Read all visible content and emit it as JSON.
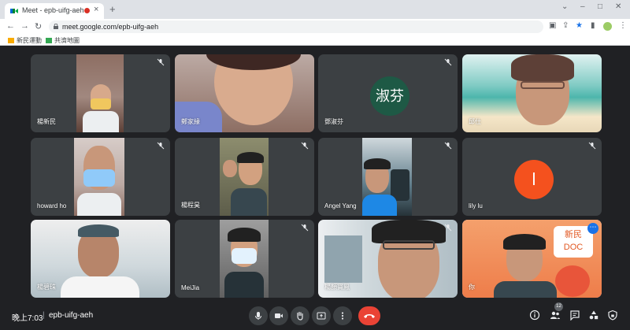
{
  "browser": {
    "tab_title": "Meet - epb-uifg-aeh",
    "new_tab_symbol": "+",
    "tab_close_symbol": "×",
    "window_minimize": "–",
    "window_maximize": "□",
    "window_close": "✕",
    "url": "meet.google.com/epb-uifg-aeh",
    "bookmarks": [
      {
        "label": "新民運動"
      },
      {
        "label": "共濟地圖"
      }
    ]
  },
  "participants": [
    {
      "name": "楊新民",
      "avatar_letter": "",
      "muted": true
    },
    {
      "name": "鄭家緣",
      "avatar_letter": "",
      "muted": false
    },
    {
      "name": "鄧淑芬",
      "avatar_letter": "淑芬",
      "avatar_color": "#1e5945",
      "muted": true
    },
    {
      "name": "邱仕",
      "avatar_letter": "",
      "muted": false
    },
    {
      "name": "howard ho",
      "avatar_letter": "",
      "muted": true
    },
    {
      "name": "楊程昊",
      "avatar_letter": "",
      "muted": true
    },
    {
      "name": "Angel Yang",
      "avatar_letter": "",
      "muted": true
    },
    {
      "name": "lily lu",
      "avatar_letter": "l",
      "avatar_color": "#f4511e",
      "muted": true
    },
    {
      "name": "楊碧珠",
      "avatar_letter": "",
      "muted": true
    },
    {
      "name": "MeiJia",
      "avatar_letter": "",
      "muted": true
    },
    {
      "name": "楊顏寶鳳",
      "avatar_letter": "",
      "muted": true
    },
    {
      "name": "你",
      "avatar_letter": "",
      "muted": false
    }
  ],
  "self_tile": {
    "sign_line1": "新民",
    "sign_line2": "DOC"
  },
  "controls": {
    "time": "晚上7:03",
    "separator": "|",
    "meeting_code": "epb-uifg-aeh",
    "participant_count": "12"
  },
  "colors": {
    "meet_background": "#202124",
    "tile_background": "#3c4043",
    "end_call": "#ea4335",
    "active_speaker": "#8ab4f8"
  }
}
